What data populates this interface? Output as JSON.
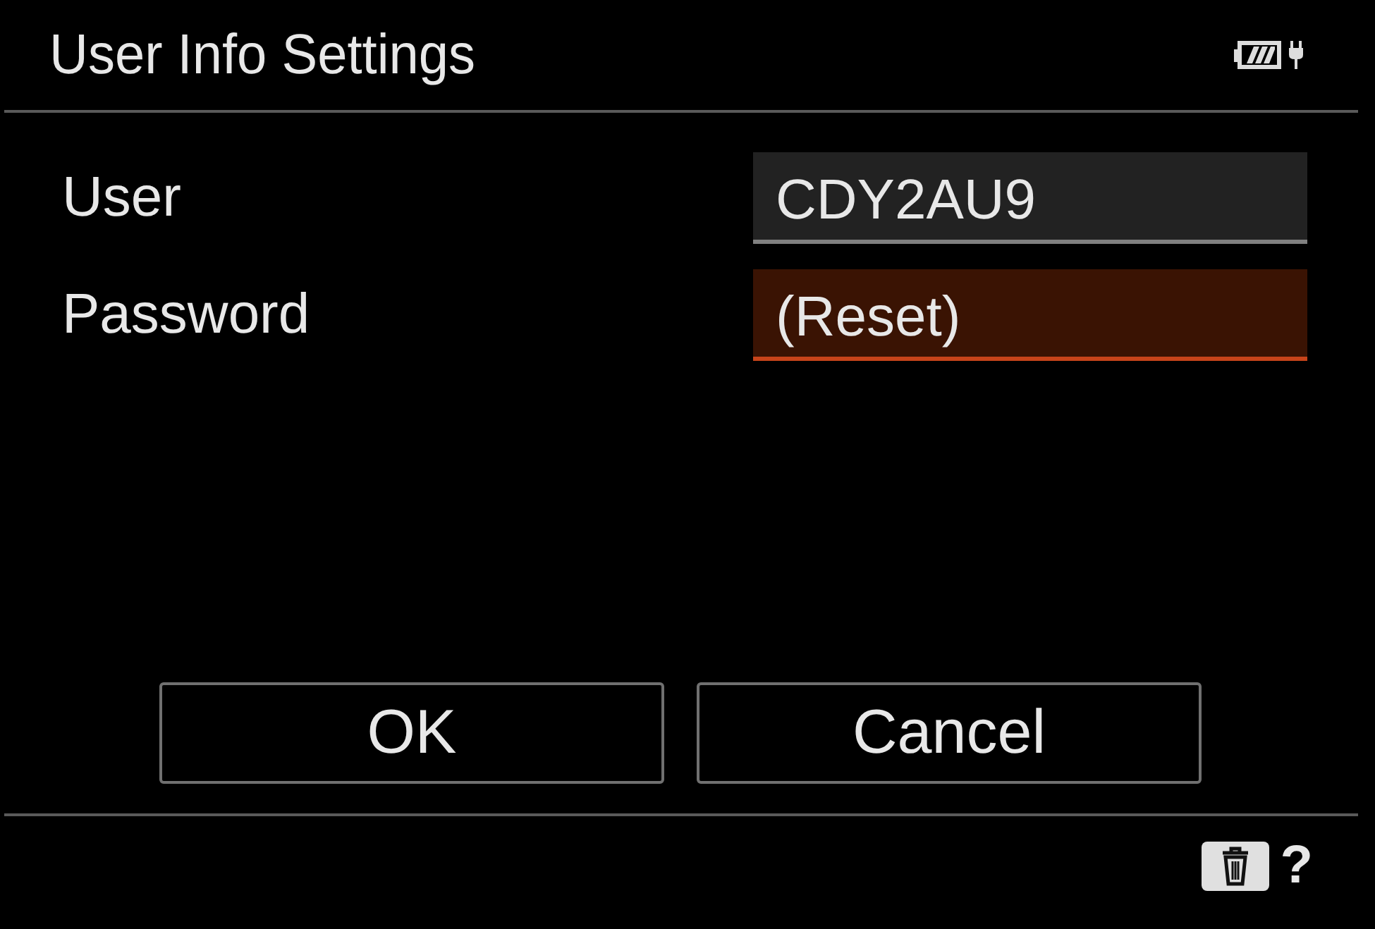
{
  "window": {
    "title": "User Info Settings"
  },
  "fields": [
    {
      "label": "User",
      "value": "CDY2AU9",
      "selected": false
    },
    {
      "label": "Password",
      "value": "(Reset)",
      "selected": true
    }
  ],
  "buttons": [
    {
      "label": "OK",
      "selected": false
    },
    {
      "label": "Cancel",
      "selected": false
    }
  ],
  "footer": {
    "help": "?"
  }
}
